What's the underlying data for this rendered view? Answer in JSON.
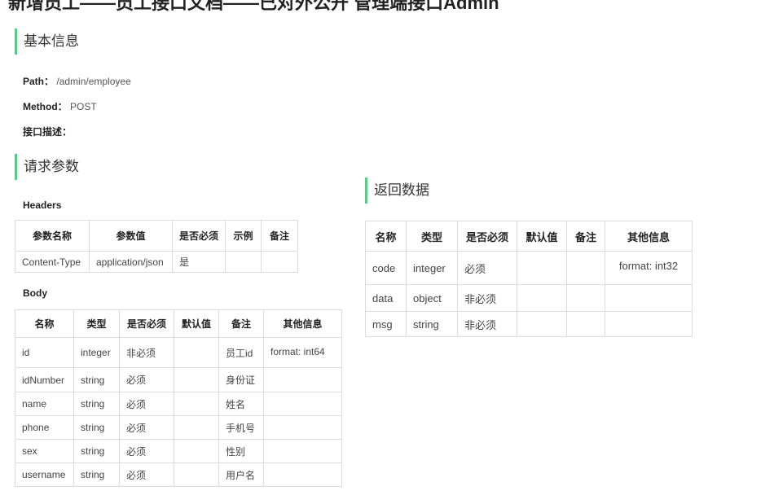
{
  "page": {
    "top_title": "新增员工——员工接口文档——已对外公开 管理端接口Admin"
  },
  "basic": {
    "title": "基本信息",
    "path_label": "Path：",
    "path_value": "/admin/employee",
    "method_label": "Method：",
    "method_value": "POST",
    "desc_label": "接口描述："
  },
  "request": {
    "title": "请求参数",
    "headers_label": "Headers",
    "headers_columns": [
      "参数名称",
      "参数值",
      "是否必须",
      "示例",
      "备注"
    ],
    "headers_rows": [
      [
        "Content-Type",
        "application/json",
        "是",
        "",
        ""
      ]
    ],
    "body_label": "Body",
    "body_columns": [
      "名称",
      "类型",
      "是否必须",
      "默认值",
      "备注",
      "其他信息"
    ],
    "body_rows": [
      [
        "id",
        "integer",
        "非必须",
        "",
        "员工id",
        "format: int64"
      ],
      [
        "idNumber",
        "string",
        "必须",
        "",
        "身份证",
        ""
      ],
      [
        "name",
        "string",
        "必须",
        "",
        "姓名",
        ""
      ],
      [
        "phone",
        "string",
        "必须",
        "",
        "手机号",
        ""
      ],
      [
        "sex",
        "string",
        "必须",
        "",
        "性别",
        ""
      ],
      [
        "username",
        "string",
        "必须",
        "",
        "用户名",
        ""
      ]
    ]
  },
  "response": {
    "title": "返回数据",
    "columns": [
      "名称",
      "类型",
      "是否必须",
      "默认值",
      "备注",
      "其他信息"
    ],
    "rows": [
      [
        "code",
        "integer",
        "必须",
        "",
        "",
        "format: int32"
      ],
      [
        "data",
        "object",
        "非必须",
        "",
        "",
        ""
      ],
      [
        "msg",
        "string",
        "非必须",
        "",
        "",
        ""
      ]
    ]
  },
  "colors": {
    "accent": "#5cc88a"
  }
}
